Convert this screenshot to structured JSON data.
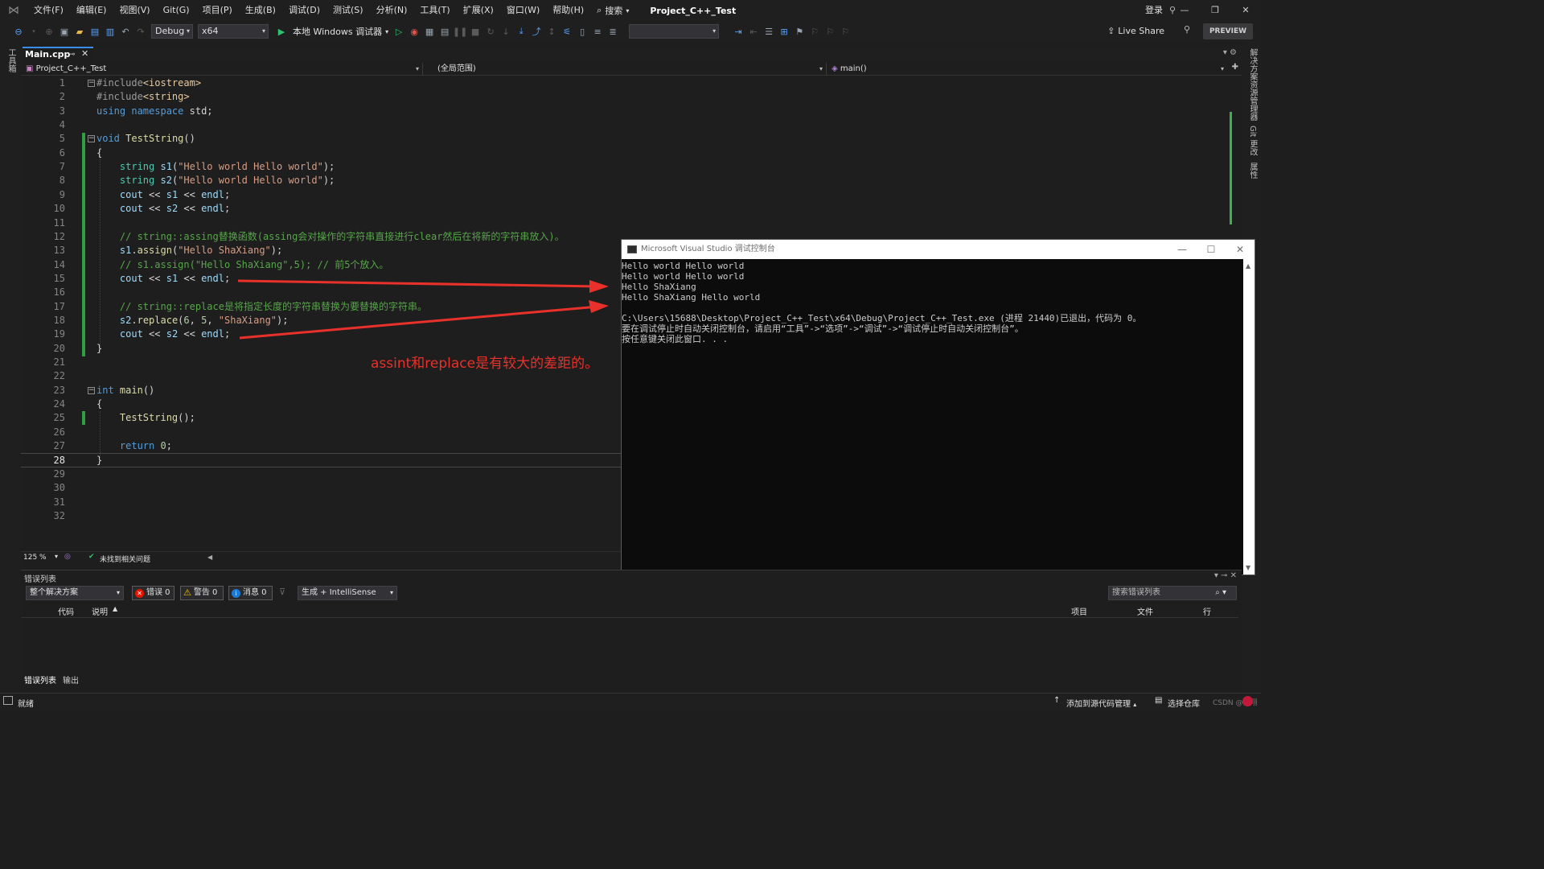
{
  "titlebar": {
    "menus": [
      "文件(F)",
      "编辑(E)",
      "视图(V)",
      "Git(G)",
      "项目(P)",
      "生成(B)",
      "调试(D)",
      "测试(S)",
      "分析(N)",
      "工具(T)",
      "扩展(X)",
      "窗口(W)",
      "帮助(H)"
    ],
    "search": "搜索",
    "project": "Project_C++_Test",
    "login": "登录"
  },
  "toolbar": {
    "config": "Debug",
    "platform": "x64",
    "run_label": "本地 Windows 调试器",
    "live_share": "Live Share",
    "preview": "PREVIEW"
  },
  "left_strip": {
    "toolbox": "工具箱"
  },
  "right_strip": {
    "solution_explorer": "解决方案资源管理器",
    "git_changes": "Git 更改",
    "properties": "属性"
  },
  "doc_tab": {
    "name": "Main.cpp"
  },
  "navbar": {
    "project": "Project_C++_Test",
    "scope": "(全局范围)",
    "member": "main()"
  },
  "editor": {
    "current_line": 28,
    "lines": [
      "#include<iostream>",
      "#include<string>",
      "using namespace std;",
      "",
      "void TestString()",
      "{",
      "    string s1(\"Hello world Hello world\");",
      "    string s2(\"Hello world Hello world\");",
      "    cout << s1 << endl;",
      "    cout << s2 << endl;",
      "",
      "    // string::assing替换函数(assing会对操作的字符串直接进行clear然后在将新的字符串放入)。",
      "    s1.assign(\"Hello ShaXiang\");",
      "    // s1.assign(\"Hello ShaXiang\",5); // 前5个放入。",
      "    cout << s1 << endl;",
      "",
      "    // string::replace是将指定长度的字符串替换为要替换的字符串。",
      "    s2.replace(6, 5, \"ShaXiang\");",
      "    cout << s2 << endl;",
      "}",
      "",
      "",
      "int main()",
      "{",
      "    TestString();",
      "",
      "    return 0;",
      "}",
      "",
      "",
      "",
      ""
    ],
    "annotation": "assint和replace是有较大的差距的。"
  },
  "editor_status": {
    "zoom": "125 %",
    "issues": "未找到相关问题"
  },
  "console": {
    "title": "Microsoft Visual Studio 调试控制台",
    "lines": [
      "Hello world Hello world",
      "Hello world Hello world",
      "Hello ShaXiang",
      "Hello ShaXiang Hello world",
      "",
      "C:\\Users\\15688\\Desktop\\Project_C++_Test\\x64\\Debug\\Project_C++_Test.exe (进程 21440)已退出，代码为 0。",
      "要在调试停止时自动关闭控制台，请启用“工具”->“选项”->“调试”->“调试停止时自动关闭控制台”。",
      "按任意键关闭此窗口. . ."
    ]
  },
  "errorlist": {
    "title": "错误列表",
    "scope": "整个解决方案",
    "errors": "错误 0",
    "warnings": "警告 0",
    "messages": "消息 0",
    "build_filter": "生成 + IntelliSense",
    "search_placeholder": "搜索错误列表",
    "columns": {
      "code": "代码",
      "desc": "说明",
      "project": "项目",
      "file": "文件",
      "line": "行"
    },
    "tabs": [
      "错误列表",
      "输出"
    ]
  },
  "statusbar": {
    "ready": "就绪",
    "add_source": "添加到源代码管理",
    "select_repo": "选择仓库",
    "watermark": "CSDN @沙翔"
  },
  "colors": {
    "accent": "#3b8ee8",
    "change_bar": "#2ea043",
    "annotation": "#e8312a"
  }
}
